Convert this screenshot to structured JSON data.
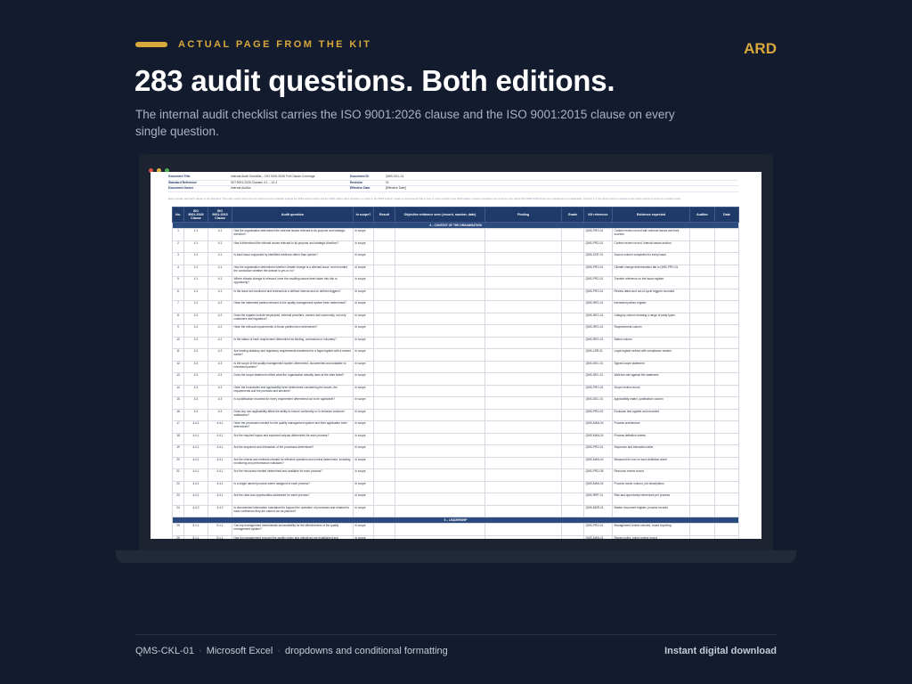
{
  "header": {
    "kicker": "ACTUAL PAGE FROM THE KIT",
    "brand": "ARD",
    "headline": "283 audit questions. Both editions.",
    "subhead": "The internal audit checklist carries the ISO 9001:2026 clause and the ISO 9001:2015 clause on every single question."
  },
  "colors": {
    "background": "#131b2e",
    "accent": "#d8a93a",
    "table_header": "#1f3a68",
    "dot_red": "#e0543f",
    "dot_yellow": "#e3b341",
    "dot_green": "#4caf50"
  },
  "document": {
    "meta": [
      {
        "k": "Document Title",
        "v": "Internal Audit Checklist – ISO 9001:2026 Full Clause Coverage",
        "k2": "Document ID",
        "v2": "QMS-CKL-01"
      },
      {
        "k": "Standard Reference",
        "v": "ISO 9001:2026 Clauses 4.1 – 10.3",
        "k2": "Revision",
        "v2": "01"
      },
      {
        "k": "Document Owner",
        "v": "Internal Auditor",
        "k2": "Effective Date",
        "v2": "[Effective Date]"
      }
    ],
    "note": "Every square and each clause of the standard. The main result column for the audit record be audited against the 2015 edition today and the 2026 edition after transition, a check in the 2015 column means a requirement that is new or more explicit in the 2026 edition. Grade a question Out of scope only where ISO 9001:2015 Annex the requirement not applicable. Confirm it in the whole point no answer of the audit column is found is not audit result."
  },
  "table": {
    "columns": [
      "No.",
      "ISO 9001:2026 Clause",
      "ISO 9001:2015 Clause",
      "Audit question",
      "In scope?",
      "Result",
      "Objective evidence seen (record, number, date)",
      "Finding",
      "Grade",
      "Kit reference",
      "Evidence expected",
      "Auditor",
      "Date"
    ],
    "sections": {
      "s4": "4 – CONTEXT OF THE ORGANISATION",
      "s5": "5 – LEADERSHIP"
    },
    "rows": [
      {
        "no": "1",
        "c26": "4.1",
        "c15": "4.1",
        "q": "Has the organisation determined the external issues relevant to its purpose and strategic direction?",
        "scope": "In scope",
        "ref": "QMS-PRO-01",
        "ev": "Context review record with external issues and their sources"
      },
      {
        "no": "2",
        "c26": "4.1",
        "c15": "4.1",
        "q": "Has it determined the internal issues relevant to its purpose and strategic direction?",
        "scope": "In scope",
        "ref": "QMS-PRO-01",
        "ev": "Context review record, internal issues section"
      },
      {
        "no": "3",
        "c26": "4.1",
        "c15": "4.1",
        "q": "Is each issue supported by identified evidence rather than opinion?",
        "scope": "In scope",
        "ref": "QMS-SOP-01",
        "ev": "Source column completed for every issue"
      },
      {
        "no": "4",
        "c26": "4.1",
        "c15": "4.1",
        "q": "Has the organisation determined whether climate change is a relevant issue, and recorded the conclusion whether the answer is yes or no?",
        "scope": "In scope",
        "ref": "QMS-PRO-01",
        "ev": "Climate change determination tab in QMS-PRO-01"
      },
      {
        "no": "5",
        "c26": "4.1",
        "c15": "4.1",
        "q": "Where climate change is relevant, have the resulting issues been taken into risk or opportunity?",
        "scope": "In scope",
        "ref": "QMS-PRO-01",
        "ev": "Transfer reference on the issue register"
      },
      {
        "no": "6",
        "c26": "4.1",
        "c15": "4.1",
        "q": "Is the issue set monitored and reviewed at a defined interval and on defined triggers?",
        "scope": "In scope",
        "ref": "QMS-PRO-01",
        "ev": "Review dates and out-of-cycle triggers recorded"
      },
      {
        "no": "7",
        "c26": "4.2",
        "c15": "4.2",
        "q": "Have the interested parties relevant to the quality management system been determined?",
        "scope": "In scope",
        "ref": "QMS-REG-01",
        "ev": "Interested parties register"
      },
      {
        "no": "8",
        "c26": "4.2",
        "c15": "4.2",
        "q": "Does the register include employees, external providers, owners and community, not only customers and regulators?",
        "scope": "In scope",
        "ref": "QMS-REG-01",
        "ev": "Category column showing a range of party types"
      },
      {
        "no": "9",
        "c26": "4.2",
        "c15": "4.2",
        "q": "Have the relevant requirements of those parties been determined?",
        "scope": "In scope",
        "ref": "QMS-REG-01",
        "ev": "Requirements column"
      },
      {
        "no": "10",
        "c26": "4.2",
        "c15": "4.2",
        "q": "Is the status of each requirement determined as binding, contractual or voluntary?",
        "scope": "In scope",
        "ref": "QMS-REG-01",
        "ev": "Status column"
      },
      {
        "no": "11",
        "c26": "4.2",
        "c15": "4.2",
        "q": "Are binding statutory and regulatory requirements transferred to a legal register with a named owner?",
        "scope": "In scope",
        "ref": "QMS-LRR-01",
        "ev": "Legal register entries with compliance owners"
      },
      {
        "no": "12",
        "c26": "4.3",
        "c15": "4.3",
        "q": "Is the scope of the quality management system determined, documented and available to interested parties?",
        "scope": "In scope",
        "ref": "QMS-DEC-01",
        "ev": "Signed scope statement"
      },
      {
        "no": "13",
        "c26": "4.3",
        "c15": "4.3",
        "q": "Does the scope statement reflect what the organisation actually does at the sites listed?",
        "scope": "In scope",
        "ref": "QMS-DEC-01",
        "ev": "Walk-the-site against the statement"
      },
      {
        "no": "14",
        "c26": "4.3",
        "c15": "4.3",
        "q": "Have the boundaries and applicability been determined considering the issues, the requirements and the products and services?",
        "scope": "In scope",
        "ref": "QMS-PRO-02",
        "ev": "Scope review record"
      },
      {
        "no": "15",
        "c26": "4.3",
        "c15": "4.3",
        "q": "Is a justification recorded for every requirement determined not to be applicable?",
        "scope": "In scope",
        "ref": "QMS-DEC-01",
        "ev": "Applicability matrix, justification column"
      },
      {
        "no": "16",
        "c26": "4.3",
        "c15": "4.3",
        "q": "Does any non-applicability affect the ability to ensure conformity or to enhance customer satisfaction?",
        "scope": "In scope",
        "ref": "QMS-PRO-02",
        "ev": "Exclusion test applied and recorded"
      },
      {
        "no": "17",
        "c26": "4.4.1",
        "c15": "4.4.1",
        "q": "Have the processes needed for the quality management system and their application been determined?",
        "scope": "In scope",
        "ref": "QMS-MAN-04",
        "ev": "Process architecture"
      },
      {
        "no": "18",
        "c26": "4.4.1",
        "c15": "4.4.1",
        "q": "Are the required inputs and expected outputs determined for each process?",
        "scope": "In scope",
        "ref": "QMS-MAN-04",
        "ev": "Process definition sheets"
      },
      {
        "no": "19",
        "c26": "4.4.1",
        "c15": "4.4.1",
        "q": "Are the sequence and interaction of the processes determined?",
        "scope": "In scope",
        "ref": "QMS-PRO-01",
        "ev": "Sequence and interaction table"
      },
      {
        "no": "20",
        "c26": "4.4.1",
        "c15": "4.4.1",
        "q": "Are the criteria and methods needed for effective operation and control determined, including monitoring and performance indicators?",
        "scope": "In scope",
        "ref": "QMS-MAN-04",
        "ev": "Measured for row on each definition sheet"
      },
      {
        "no": "21",
        "c26": "4.4.1",
        "c15": "4.4.1",
        "q": "Are the resources needed determined and available for each process?",
        "scope": "In scope",
        "ref": "QMS-PRO-08",
        "ev": "Resource review record"
      },
      {
        "no": "22",
        "c26": "4.4.1",
        "c15": "4.4.1",
        "q": "Is a single named process owner assigned to each process?",
        "scope": "In scope",
        "ref": "QMS-MAN-04",
        "ev": "Process owner column, job descriptions"
      },
      {
        "no": "23",
        "c26": "4.4.1",
        "c15": "4.4.1",
        "q": "Are the risks and opportunities addressed for each process?",
        "scope": "In scope",
        "ref": "QMS-RRP-01",
        "ev": "Risk and opportunity references per process"
      },
      {
        "no": "24",
        "c26": "4.4.2",
        "c15": "4.4.2",
        "q": "Is documented information maintained to support the operation of processes and retained to have confidence they are carried out as planned?",
        "scope": "In scope",
        "ref": "QMS-MDR-01",
        "ev": "Master document register, process records"
      },
      {
        "no": "25",
        "c26": "5.1.1",
        "c15": "5.1.1",
        "q": "Can top management demonstrate accountability for the effectiveness of the quality management system?",
        "scope": "In scope",
        "ref": "QMS-PRO-01",
        "ev": "Management review minutes, board reporting"
      },
      {
        "no": "26",
        "c26": "5.1.1",
        "c15": "5.1.1",
        "q": "Has top management ensured the quality policy and objectives are established and compatible with the context and strategic direction?",
        "scope": "In scope",
        "ref": "QMS-MAN-01",
        "ev": "Signed policy, policy review record"
      }
    ]
  },
  "footer": {
    "items": [
      "QMS-CKL-01",
      "Microsoft Excel",
      "dropdowns and conditional formatting"
    ],
    "separator": "·",
    "right": "Instant digital download"
  }
}
